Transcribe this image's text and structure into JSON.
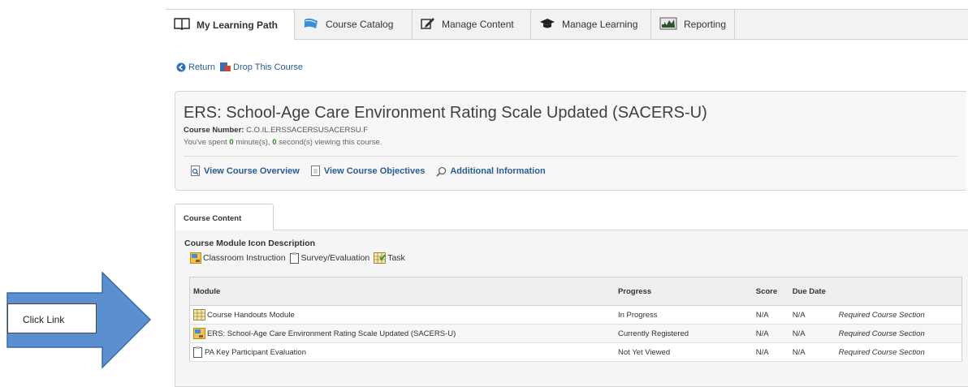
{
  "tabs": [
    {
      "label": "My Learning Path",
      "icon": "book-icon"
    },
    {
      "label": "Course Catalog",
      "icon": "catalog-icon"
    },
    {
      "label": "Manage Content",
      "icon": "edit-icon"
    },
    {
      "label": "Manage Learning",
      "icon": "graduation-cap-icon"
    },
    {
      "label": "Reporting",
      "icon": "chart-icon"
    }
  ],
  "actions": {
    "return_label": "Return",
    "drop_label": "Drop This Course"
  },
  "course": {
    "title": "ERS: School-Age Care Environment Rating Scale Updated (SACERS-U)",
    "number_label": "Course Number:",
    "number_value": "C.O.IL.ERSSACERSUSACERSU.F",
    "time_prefix": "You've spent",
    "minutes": "0",
    "minutes_suffix": "minute(s),",
    "seconds": "0",
    "seconds_suffix": "second(s) viewing this course."
  },
  "header_links": {
    "overview": "View Course Overview",
    "objectives": "View Course Objectives",
    "additional": "Additional Information"
  },
  "content_tab": "Course Content",
  "legend": {
    "title": "Course Module Icon Description",
    "classroom": "Classroom Instruction",
    "survey": "Survey/Evaluation",
    "task": "Task"
  },
  "table": {
    "headers": {
      "module": "Module",
      "progress": "Progress",
      "score": "Score",
      "due": "Due Date"
    },
    "rows": [
      {
        "module": "Course Handouts Module",
        "type": "task",
        "progress": "In Progress",
        "score": "N/A",
        "due": "N/A",
        "note": "Required Course Section"
      },
      {
        "module": "ERS: School-Age Care Environment Rating Scale Updated (SACERS-U)",
        "type": "classroom",
        "progress": "Currently Registered",
        "score": "N/A",
        "due": "N/A",
        "note": "Required Course Section"
      },
      {
        "module": "PA Key Participant Evaluation",
        "type": "survey",
        "progress": "Not Yet Viewed",
        "score": "N/A",
        "due": "N/A",
        "note": "Required Course Section"
      }
    ]
  },
  "callout": {
    "label": "Click Link",
    "arrow_color": "#5b8fd0"
  }
}
